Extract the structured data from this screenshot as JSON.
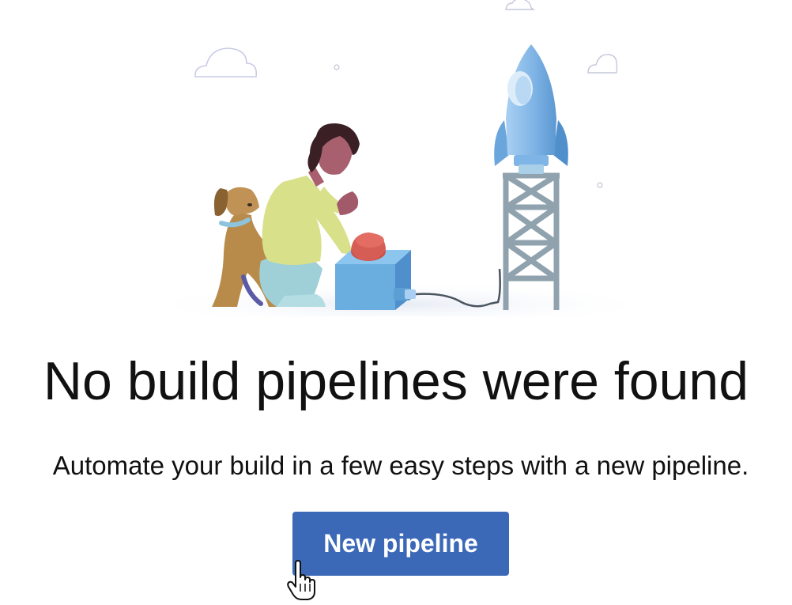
{
  "empty_state": {
    "title": "No build pipelines were found",
    "description": "Automate your build in a few easy steps with a new pipeline.",
    "button_label": "New pipeline"
  },
  "colors": {
    "button_background": "#3b69b7",
    "button_text": "#ffffff",
    "text": "#111111",
    "rocket": "#7fb4e6",
    "tower": "#8fa2ad"
  },
  "icons": {
    "cursor": "hand-pointer-icon"
  }
}
